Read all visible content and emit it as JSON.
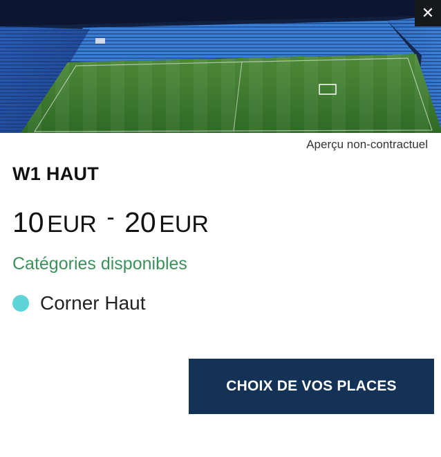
{
  "hero": {
    "alt": "Stadium seat view",
    "close_icon": "close-icon",
    "expand_icon": "expand-icon"
  },
  "disclaimer": "Aperçu non-contractuel",
  "section": {
    "title": "W1 HAUT"
  },
  "price": {
    "min": "10",
    "min_currency": "EUR",
    "separator": "-",
    "max": "20",
    "max_currency": "EUR"
  },
  "categories": {
    "heading": "Catégories disponibles",
    "items": [
      {
        "label": "Corner Haut",
        "color": "#5ed4d6"
      }
    ]
  },
  "cta": {
    "label": "CHOIX DE VOS PLACES"
  },
  "colors": {
    "accent_green": "#3d8f5c",
    "cta_bg": "#143156",
    "close_bg": "#17181c"
  }
}
